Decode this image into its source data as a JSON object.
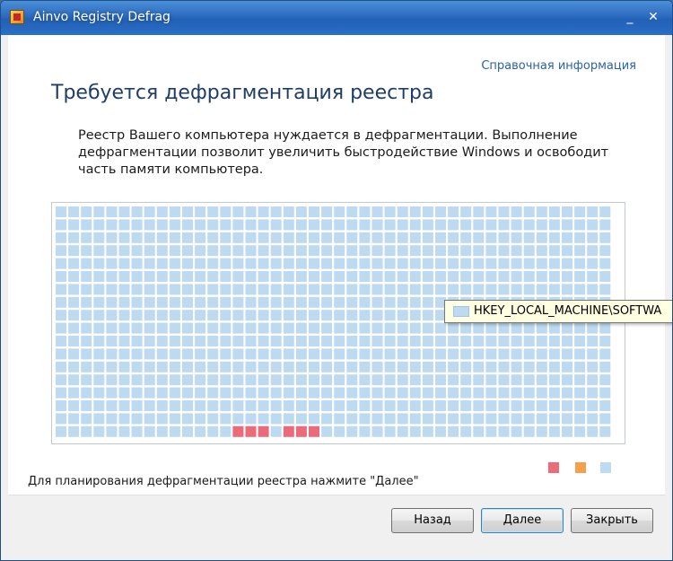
{
  "window": {
    "title": "Ainvo Registry Defrag"
  },
  "titlebar": {
    "minimize_glyph": "_",
    "close_glyph": "✕"
  },
  "help": {
    "link_label": "Справочная информация"
  },
  "main": {
    "heading": "Требуется дефрагментация реестра",
    "description": "Реестр Вашего компьютера нуждается в дефрагментации. Выполнение дефрагментации позволит увеличить быстродействие Windows и освободит часть памяти компьютера."
  },
  "grid": {
    "columns": 44,
    "rows": 18,
    "fragmented_cells": [
      {
        "row": 17,
        "col": 14
      },
      {
        "row": 17,
        "col": 15
      },
      {
        "row": 17,
        "col": 16
      },
      {
        "row": 17,
        "col": 18
      },
      {
        "row": 17,
        "col": 19
      },
      {
        "row": 17,
        "col": 20
      }
    ],
    "colors": {
      "normal": "#bedaf1",
      "fragmented": "#ec6a79"
    }
  },
  "tooltip": {
    "text": "HKEY_LOCAL_MACHINE\\SOFTWA"
  },
  "legend": {
    "colors": [
      "#ec6a79",
      "#f5a04a",
      "#bcdcf4"
    ]
  },
  "footer": {
    "hint": "Для планирования дефрагментации реестра нажмите \"Далее\""
  },
  "buttons": {
    "back_label": "Назад",
    "next_label": "Далее",
    "close_label": "Закрыть"
  }
}
